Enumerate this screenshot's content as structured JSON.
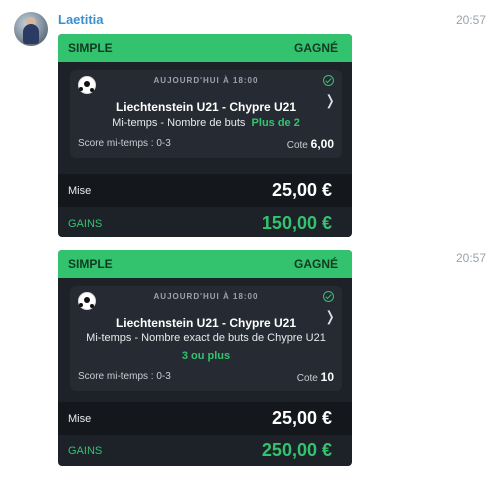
{
  "sender": "Laetitia",
  "messages": [
    {
      "time": "20:57",
      "ticket": {
        "type": "SIMPLE",
        "status": "GAGNÉ",
        "date": "AUJOURD'HUI À 18:00",
        "match": "Liechtenstein U21 - Chypre U21",
        "market": "Mi-temps - Nombre de buts",
        "selection": "Plus de 2",
        "score": "Score mi-temps : 0-3",
        "cote_label": "Cote",
        "cote_value": "6,00",
        "mise_label": "Mise",
        "mise_value": "25,00 €",
        "gains_label": "GAINS",
        "gains_value": "150,00 €"
      }
    },
    {
      "time": "20:57",
      "ticket": {
        "type": "SIMPLE",
        "status": "GAGNÉ",
        "date": "AUJOURD'HUI À 18:00",
        "match": "Liechtenstein U21 - Chypre U21",
        "market": "Mi-temps - Nombre exact de buts de Chypre U21",
        "selection": "3 ou plus",
        "score": "Score mi-temps : 0-3",
        "cote_label": "Cote",
        "cote_value": "10",
        "mise_label": "Mise",
        "mise_value": "25,00 €",
        "gains_label": "GAINS",
        "gains_value": "250,00 €"
      }
    }
  ],
  "colors": {
    "accent_green": "#33c36f",
    "sender_blue": "#3a8fd1",
    "ticket_bg": "#1d2128"
  },
  "icons": [
    "avatar",
    "football-icon",
    "check-circle-icon",
    "chevron-right-icon"
  ]
}
